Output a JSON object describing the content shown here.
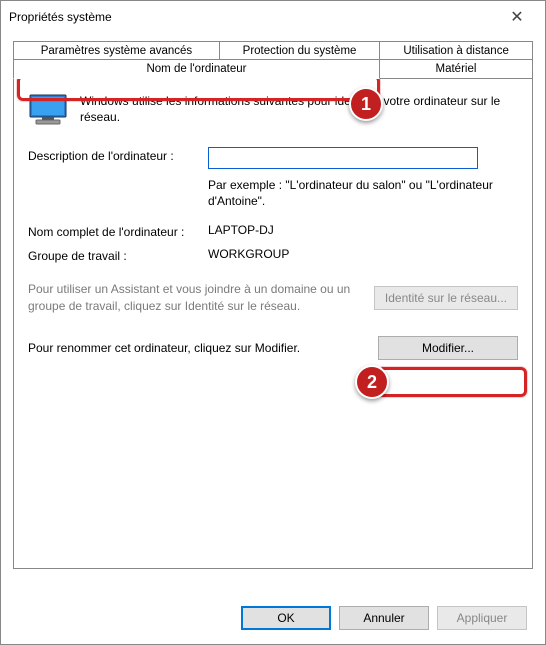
{
  "window": {
    "title": "Propriétés système"
  },
  "tabs": {
    "row1": [
      {
        "label": "Paramètres système avancés"
      },
      {
        "label": "Protection du système"
      },
      {
        "label": "Utilisation à distance"
      }
    ],
    "row2": [
      {
        "label": "Nom de l'ordinateur",
        "active": true
      },
      {
        "label": "Matériel"
      }
    ]
  },
  "intro": "Windows utilise les informations suivantes pour identifier votre ordinateur sur le réseau.",
  "description": {
    "label": "Description de l'ordinateur :",
    "value": "",
    "example": "Par exemple : \"L'ordinateur du salon\" ou \"L'ordinateur d'Antoine\"."
  },
  "fullname": {
    "label": "Nom complet de l'ordinateur :",
    "value": "LAPTOP-DJ"
  },
  "workgroup": {
    "label": "Groupe de travail :",
    "value": "WORKGROUP"
  },
  "assist": {
    "text": "Pour utiliser un Assistant et vous joindre à un domaine ou un groupe de travail, cliquez sur Identité sur le réseau.",
    "button": "Identité sur le réseau..."
  },
  "modify": {
    "text": "Pour renommer cet ordinateur, cliquez sur Modifier.",
    "button": "Modifier..."
  },
  "buttons": {
    "ok": "OK",
    "cancel": "Annuler",
    "apply": "Appliquer"
  },
  "annotations": {
    "badge1": "1",
    "badge2": "2"
  }
}
